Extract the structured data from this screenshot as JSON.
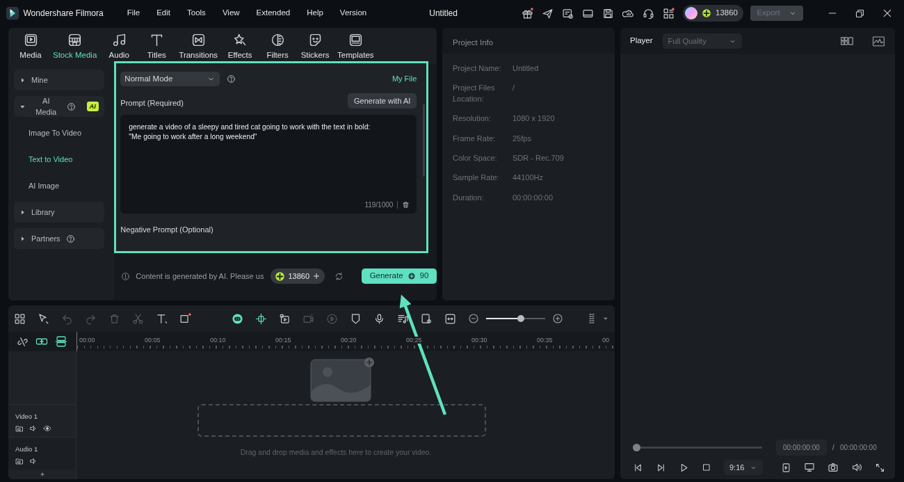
{
  "app": {
    "name": "Wondershare Filmora"
  },
  "menu": [
    "File",
    "Edit",
    "Tools",
    "View",
    "Extended",
    "Help",
    "Version"
  ],
  "document_title": "Untitled",
  "account": {
    "credits": "13860"
  },
  "export": {
    "label": "Export",
    "disabled": true
  },
  "media_tabs": [
    {
      "label": "Media",
      "selected": false
    },
    {
      "label": "Stock Media",
      "selected": true
    },
    {
      "label": "Audio",
      "selected": false
    },
    {
      "label": "Titles",
      "selected": false
    },
    {
      "label": "Transitions",
      "selected": false
    },
    {
      "label": "Effects",
      "selected": false
    },
    {
      "label": "Filters",
      "selected": false
    },
    {
      "label": "Stickers",
      "selected": false
    },
    {
      "label": "Templates",
      "selected": false
    }
  ],
  "sidebar": [
    {
      "kind": "group",
      "label": "Mine",
      "expanded": false
    },
    {
      "kind": "group",
      "label": "AI Media",
      "expanded": true,
      "help": true,
      "badge": "AI"
    },
    {
      "kind": "item",
      "label": "Image To Video",
      "selected": false
    },
    {
      "kind": "item",
      "label": "Text to Video",
      "selected": true
    },
    {
      "kind": "item",
      "label": "AI Image",
      "selected": false
    },
    {
      "kind": "group",
      "label": "Library",
      "expanded": false
    },
    {
      "kind": "group",
      "label": "Partners",
      "expanded": false,
      "help": true
    }
  ],
  "generator": {
    "mode": "Normal Mode",
    "my_file": "My File",
    "prompt_label": "Prompt (Required)",
    "generate_with_ai": "Generate with AI",
    "prompt": "generate a video of a sleepy and tired cat going to work with the text in bold:\n\"Me going to work after a long weekend\"",
    "counter": "119/1000",
    "negative_label": "Negative Prompt (Optional)",
    "notice": "Content is generated by AI. Please us",
    "credits": "13860",
    "generate_label": "Generate",
    "generate_cost": "90"
  },
  "project_info": {
    "title": "Project Info",
    "fields": [
      {
        "label": "Project Name:",
        "value": "Untitled"
      },
      {
        "label": "Project Files Location:",
        "value": "/"
      },
      {
        "label": "Resolution:",
        "value": "1080 x 1920"
      },
      {
        "label": "Frame Rate:",
        "value": "25fps"
      },
      {
        "label": "Color Space:",
        "value": "SDR - Rec.709"
      },
      {
        "label": "Sample Rate:",
        "value": "44100Hz"
      },
      {
        "label": "Duration:",
        "value": "00:00:00:00"
      }
    ]
  },
  "player": {
    "title": "Player",
    "quality": "Full Quality",
    "level": 0,
    "current": "00:00:00:00",
    "separator": "/",
    "total": "00:00:00:00",
    "ratio": "9:16"
  },
  "timeline": {
    "zoom": {
      "level": 0.6
    },
    "ruler": [
      "00:00",
      "00:05",
      "00:10",
      "00:15",
      "00:20",
      "00:25",
      "00:30",
      "00:35",
      "00"
    ],
    "tracks": [
      {
        "kind": "video",
        "name": "Video 1"
      },
      {
        "kind": "audio",
        "name": "Audio 1"
      }
    ],
    "drop_hint": "Drag and drop media and effects here to create your video."
  }
}
